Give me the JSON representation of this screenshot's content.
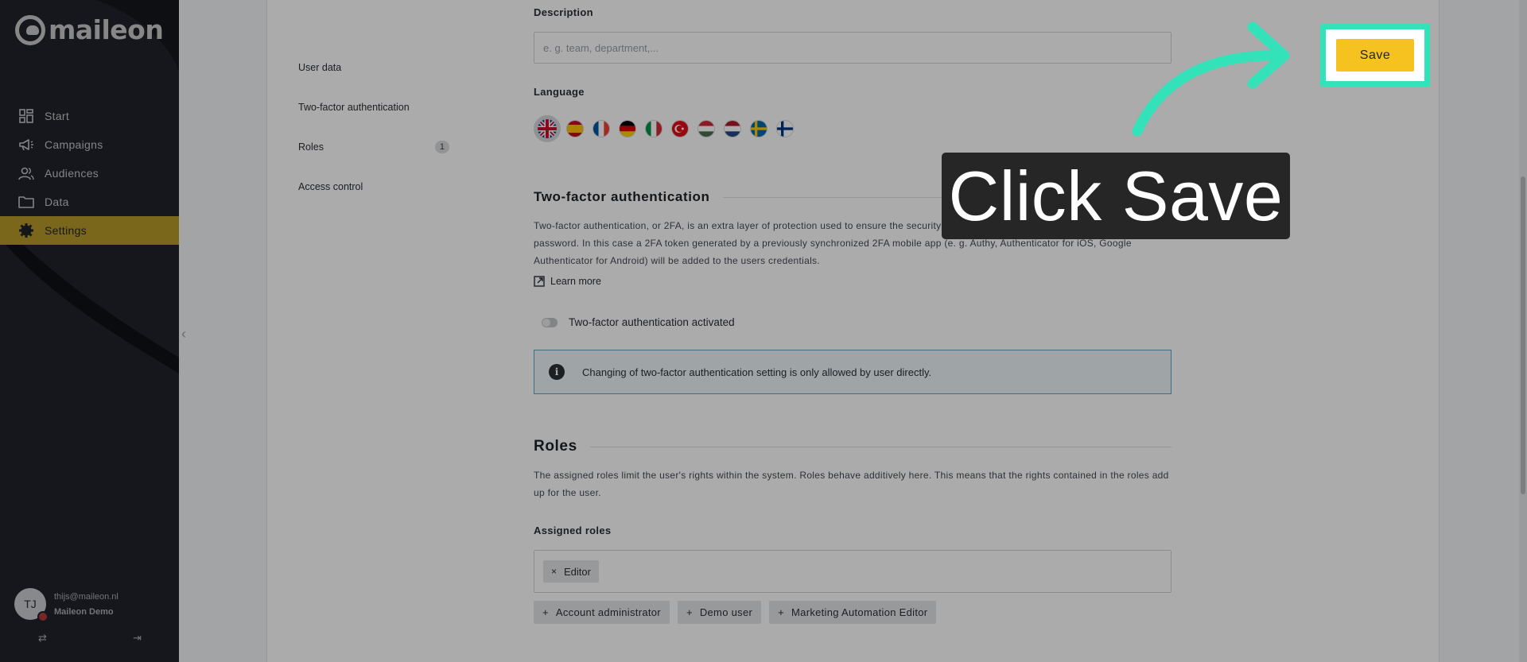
{
  "app": {
    "brand": "maileon"
  },
  "sidebar": {
    "items": [
      {
        "label": "Start",
        "icon": "dashboard-icon"
      },
      {
        "label": "Campaigns",
        "icon": "megaphone-icon"
      },
      {
        "label": "Audiences",
        "icon": "users-icon"
      },
      {
        "label": "Data",
        "icon": "folder-icon"
      },
      {
        "label": "Settings",
        "icon": "gear-icon",
        "active": true
      }
    ],
    "user": {
      "initials": "TJ",
      "email": "thijs@maileon.nl",
      "account": "Maileon Demo"
    }
  },
  "subnav": {
    "items": [
      {
        "label": "User data"
      },
      {
        "label": "Two-factor authentication"
      },
      {
        "label": "Roles",
        "badge": "1"
      },
      {
        "label": "Access control"
      }
    ]
  },
  "form": {
    "description_label": "Description",
    "description_placeholder": "e. g. team, department,...",
    "language_label": "Language",
    "languages": [
      "en",
      "es",
      "fr",
      "de",
      "it",
      "tr",
      "hu",
      "nl",
      "sv",
      "fi"
    ]
  },
  "twofa": {
    "title": "Two-factor authentication",
    "text": "Two-factor authentication, or 2FA, is an extra layer of protection used to ensure the security of online accounts beyond just a username and password. In this case a 2FA token generated by a previously synchronized 2FA mobile app (e. g. Authy, Authenticator for iOS, Google Authenticator for Android) will be added to the users credentials.",
    "learn_more": "Learn more",
    "toggle_label": "Two-factor authentication activated",
    "info": "Changing of two-factor authentication setting is only allowed by user directly."
  },
  "roles": {
    "title": "Roles",
    "text": "The assigned roles limit the user's rights within the system. Roles behave additively here. This means that the rights contained in the roles add up for the user.",
    "assigned_label": "Assigned roles",
    "assigned": [
      "Editor"
    ],
    "available": [
      "Account administrator",
      "Demo user",
      "Marketing Automation Editor"
    ]
  },
  "toolbar": {
    "save_label": "Save"
  },
  "annotation": {
    "callout": "Click Save",
    "highlight_color": "#34e2b9"
  },
  "colors": {
    "accent": "#f5c21f",
    "sidebar": "#20232a",
    "active_nav": "#b79a2a"
  }
}
